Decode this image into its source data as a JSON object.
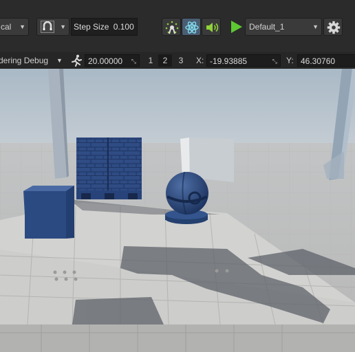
{
  "toolbar": {
    "coord_space": "cal",
    "step_size_label": "Step Size",
    "step_size_value": "0.100",
    "profile": "Default_1",
    "icons": {
      "magnet": "magnet-icon",
      "particles": "particles-icon",
      "physics": "atom-icon",
      "audio": "speaker-icon",
      "play": "play-icon",
      "settings": "gear-icon"
    }
  },
  "debug_bar": {
    "mode": "dering Debug",
    "speed_icon": "running-person-icon",
    "speed_value": "20.00000",
    "layouts": [
      "1",
      "2",
      "3"
    ],
    "selected_layout": "2",
    "x_label": "X:",
    "x_value": "-19.93885",
    "y_label": "Y:",
    "y_value": "46.30760"
  },
  "colors": {
    "toolbar_bg": "#2b2b2b",
    "active_button": "#4a5d72",
    "play_green": "#5ec832",
    "sky": "#b6c3cf",
    "floor": "#c9c9c7",
    "blue_props": "#2d4b82"
  }
}
